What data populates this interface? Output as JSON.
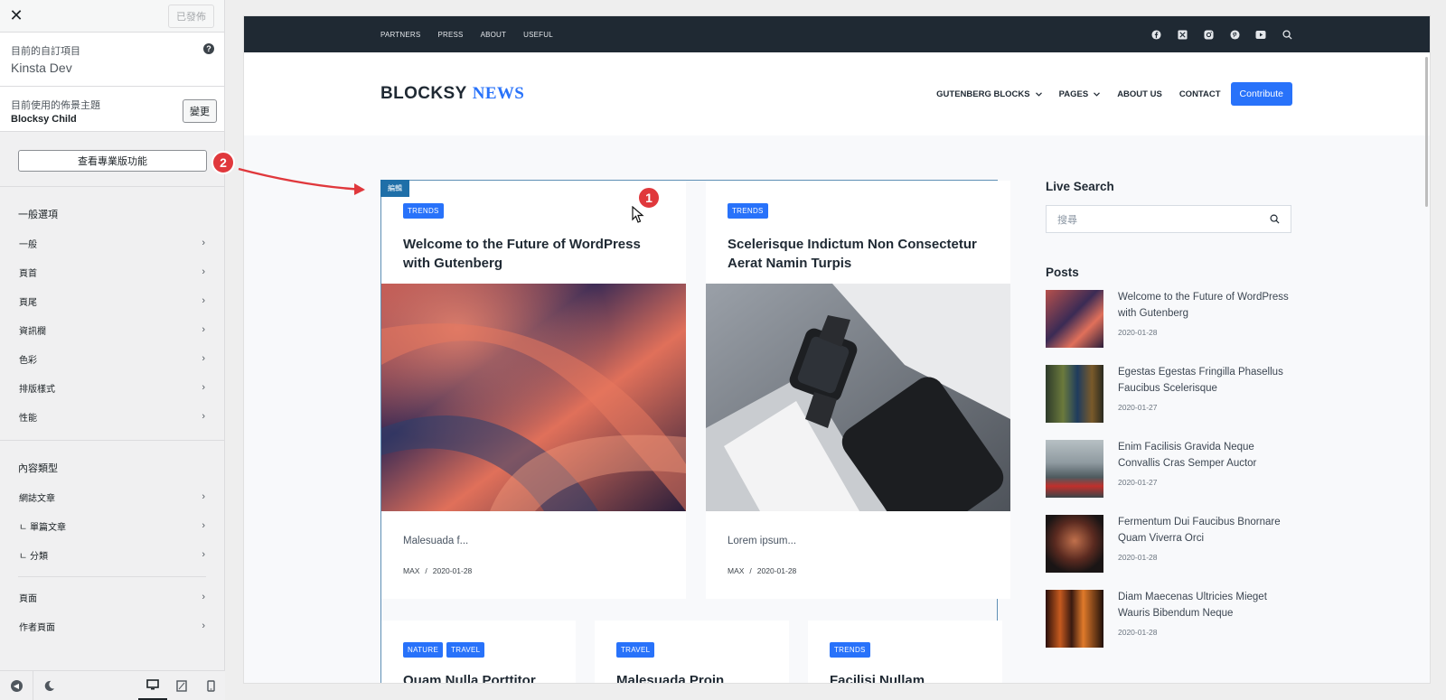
{
  "sidebar": {
    "close_glyph": "✕",
    "published_label": "已發佈",
    "current_customizing_label": "目前的自訂項目",
    "current_customizing_value": "Kinsta Dev",
    "help_glyph": "?",
    "active_theme_label": "目前使用的佈景主題",
    "active_theme_value": "Blocksy Child",
    "change_label": "變更",
    "pro_features_label": "查看專業版功能",
    "general_section_title": "一般選項",
    "general_items": [
      {
        "label": "一般"
      },
      {
        "label": "頁首"
      },
      {
        "label": "頁尾"
      },
      {
        "label": "資訊欄"
      },
      {
        "label": "色彩"
      },
      {
        "label": "排版樣式"
      },
      {
        "label": "性能"
      }
    ],
    "content_section_title": "內容類型",
    "content_items": [
      {
        "label": "網誌文章"
      },
      {
        "label": "ㄴ 單篇文章"
      },
      {
        "label": "ㄴ 分類"
      }
    ],
    "page_items": [
      {
        "label": "頁面"
      },
      {
        "label": "作者頁面"
      }
    ],
    "chevron": "›"
  },
  "annotations": {
    "badge1": "1",
    "badge2": "2",
    "accent": "#e0383c"
  },
  "preview": {
    "topnav": [
      "PARTNERS",
      "PRESS",
      "ABOUT",
      "USEFUL"
    ],
    "social_icons": [
      "facebook-icon",
      "x-twitter-icon",
      "instagram-icon",
      "pinterest-icon",
      "youtube-icon",
      "search-icon"
    ],
    "logo_part1": "BLOCKSY",
    "logo_part2": "NEWS",
    "mainnav": [
      {
        "label": "GUTENBERG BLOCKS",
        "has_dropdown": true
      },
      {
        "label": "PAGES",
        "has_dropdown": true
      },
      {
        "label": "ABOUT US",
        "has_dropdown": false
      },
      {
        "label": "CONTACT",
        "has_dropdown": false
      }
    ],
    "contribute_label": "Contribute",
    "edit_tag": "編輯",
    "brand_color": "#2872fa",
    "cards": [
      {
        "tags": [
          "TRENDS"
        ],
        "title": "Welcome to the Future of WordPress with Gutenberg",
        "excerpt": "Malesuada f...",
        "author": "MAX",
        "separator": "/",
        "date": "2020-01-28"
      },
      {
        "tags": [
          "TRENDS"
        ],
        "title": "Scelerisque Indictum Non Consectetur Aerat Namin Turpis",
        "excerpt": "Lorem ipsum...",
        "author": "MAX",
        "separator": "/",
        "date": "2020-01-28"
      }
    ],
    "small_cards": [
      {
        "tags": [
          "NATURE",
          "TRAVEL"
        ],
        "title": "Quam Nulla Porttitor"
      },
      {
        "tags": [
          "TRAVEL"
        ],
        "title": "Malesuada Proin"
      },
      {
        "tags": [
          "TRENDS"
        ],
        "title": "Facilisi Nullam"
      }
    ],
    "aside": {
      "live_search_title": "Live Search",
      "search_placeholder": "搜尋",
      "posts_title": "Posts",
      "posts": [
        {
          "title": "Welcome to the Future of WordPress with Gutenberg",
          "date": "2020-01-28"
        },
        {
          "title": "Egestas Egestas Fringilla Phasellus Faucibus Scelerisque",
          "date": "2020-01-27"
        },
        {
          "title": "Enim Facilisis Gravida Neque Convallis Cras Semper Auctor",
          "date": "2020-01-27"
        },
        {
          "title": "Fermentum Dui Faucibus Bnornare Quam Viverra Orci",
          "date": "2020-01-28"
        },
        {
          "title": "Diam Maecenas Ultricies Mieget Wauris Bibendum Neque",
          "date": "2020-01-28"
        }
      ]
    }
  }
}
